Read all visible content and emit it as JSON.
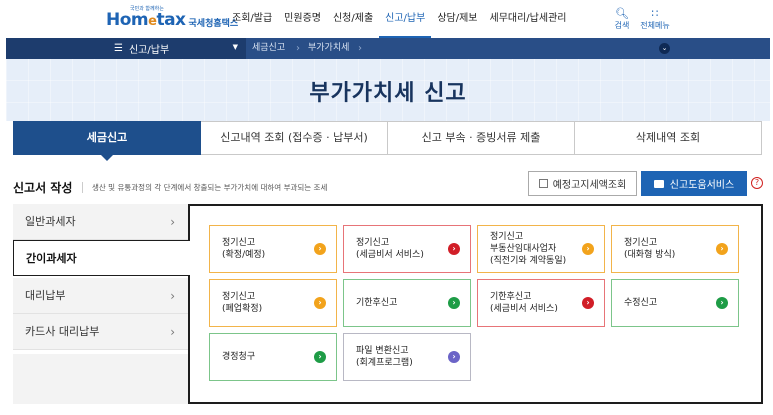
{
  "header": {
    "logo_main_left": "Hom",
    "logo_main_e": "e",
    "logo_main_right": "tax",
    "logo_tagline": "국민과 함께하는",
    "logo_sub": "국세청홈택스",
    "nav": [
      "조회/발급",
      "민원증명",
      "신청/제출",
      "신고/납부",
      "상담/제보",
      "세무대리/납세관리"
    ],
    "active_nav_index": 3,
    "search_label": "검색",
    "allmenu_label": "전체메뉴"
  },
  "breadcrumb": {
    "menu_label": "신고/납부",
    "items": [
      "세금신고",
      "부가가치세"
    ]
  },
  "page": {
    "title": "부가가치세 신고"
  },
  "tabs": [
    {
      "label": "세금신고",
      "active": true
    },
    {
      "label": "신고내역 조회 (접수증 · 납부서)",
      "active": false
    },
    {
      "label": "신고 부속 · 증빙서류 제출",
      "active": false
    },
    {
      "label": "삭제내역 조회",
      "active": false
    }
  ],
  "section": {
    "title": "신고서 작성",
    "desc": "생산 및 유통과정의 각 단계에서 창출되는 부가가치에 대하여 부과되는 조세",
    "btn_outline": "예정고지세액조회",
    "btn_primary": "신고도움서비스",
    "help": "?"
  },
  "side_menu": [
    {
      "label": "일반과세자",
      "active": false
    },
    {
      "label": "간이과세자",
      "active": true
    },
    {
      "label": "대리납부",
      "active": false
    },
    {
      "label": "카드사 대리납부",
      "active": false
    }
  ],
  "cards": [
    {
      "label": "정기신고\n(확정/예정)",
      "color": "orange"
    },
    {
      "label": "정기신고\n(세금비서 서비스)",
      "color": "red"
    },
    {
      "label": "정기신고\n부동산임대사업자\n(직전기와 계약동일)",
      "color": "orange"
    },
    {
      "label": "정기신고\n(대화형 방식)",
      "color": "orange"
    },
    {
      "label": "정기신고\n(폐업확정)",
      "color": "orange"
    },
    {
      "label": "기한후신고",
      "color": "green"
    },
    {
      "label": "기한후신고\n(세금비서 서비스)",
      "color": "red"
    },
    {
      "label": "수정신고",
      "color": "green"
    },
    {
      "label": "경정청구",
      "color": "green"
    },
    {
      "label": "파일 변환신고\n(회계프로그램)",
      "color": "purple"
    }
  ],
  "colors": {
    "primary": "#1e64b4",
    "navy": "#294e87",
    "orange": "#f2a31c",
    "red": "#d11e27",
    "green": "#1e9c46",
    "purple": "#6b64c7"
  }
}
